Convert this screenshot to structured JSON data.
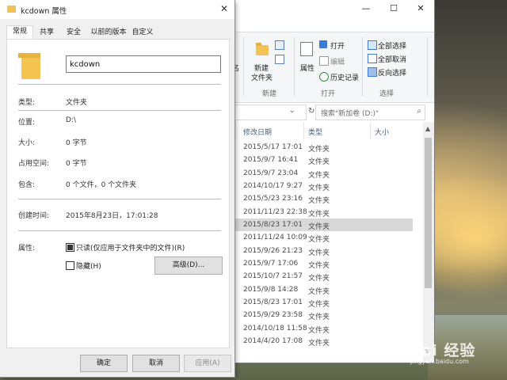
{
  "explorer": {
    "ribbon": {
      "name_partial": "名",
      "new_folder_label_1": "新建",
      "new_folder_label_2": "文件夹",
      "new_group": "新建",
      "properties_label": "属性",
      "open_label": "打开",
      "edit_label": "编辑",
      "history_label": "历史记录",
      "open_group": "打开",
      "select_all": "全部选择",
      "select_none": "全部取消",
      "invert_select": "反向选择",
      "select_group": "选择"
    },
    "search_placeholder": "搜索\"新加卷 (D:)\"",
    "columns": {
      "date": "修改日期",
      "type": "类型",
      "size": "大小"
    },
    "rows": [
      {
        "date": "2015/5/17 17:01",
        "type": "文件夹"
      },
      {
        "date": "2015/9/7 16:41",
        "type": "文件夹"
      },
      {
        "date": "2015/9/7 23:04",
        "type": "文件夹"
      },
      {
        "date": "2014/10/17 9:27",
        "type": "文件夹"
      },
      {
        "date": "2015/5/23 23:16",
        "type": "文件夹"
      },
      {
        "date": "2011/11/23 22:38",
        "type": "文件夹"
      },
      {
        "date": "2015/8/23 17:01",
        "type": "文件夹"
      },
      {
        "date": "2011/11/24 10:09",
        "type": "文件夹"
      },
      {
        "date": "2015/9/26 21:23",
        "type": "文件夹"
      },
      {
        "date": "2015/9/7 17:06",
        "type": "文件夹"
      },
      {
        "date": "2015/10/7 21:57",
        "type": "文件夹"
      },
      {
        "date": "2015/9/8 14:28",
        "type": "文件夹"
      },
      {
        "date": "2015/8/23 17:01",
        "type": "文件夹"
      },
      {
        "date": "2015/9/29 23:58",
        "type": "文件夹"
      },
      {
        "date": "2014/10/18 11:58",
        "type": "文件夹"
      },
      {
        "date": "2014/4/20 17:08",
        "type": "文件夹"
      }
    ]
  },
  "props": {
    "title": "kcdown 属性",
    "tabs": [
      "常规",
      "共享",
      "安全",
      "以前的版本",
      "自定义"
    ],
    "name_value": "kcdown",
    "type_label": "类型:",
    "type_value": "文件夹",
    "location_label": "位置:",
    "location_value": "D:\\",
    "size_label": "大小:",
    "size_value": "0 字节",
    "disk_label": "占用空间:",
    "disk_value": "0 字节",
    "contains_label": "包含:",
    "contains_value": "0 个文件，0 个文件夹",
    "created_label": "创建时间:",
    "created_value": "2015年8月23日，17:01:28",
    "attr_label": "属性:",
    "readonly_label": "只读(仅应用于文件夹中的文件)(R)",
    "hidden_label": "隐藏(H)",
    "advanced_button": "高级(D)...",
    "ok_button": "确定",
    "cancel_button": "取消",
    "apply_button": "应用(A)"
  },
  "watermark": {
    "text": "Bai 经验",
    "url": "jingyan.baidu.com"
  }
}
